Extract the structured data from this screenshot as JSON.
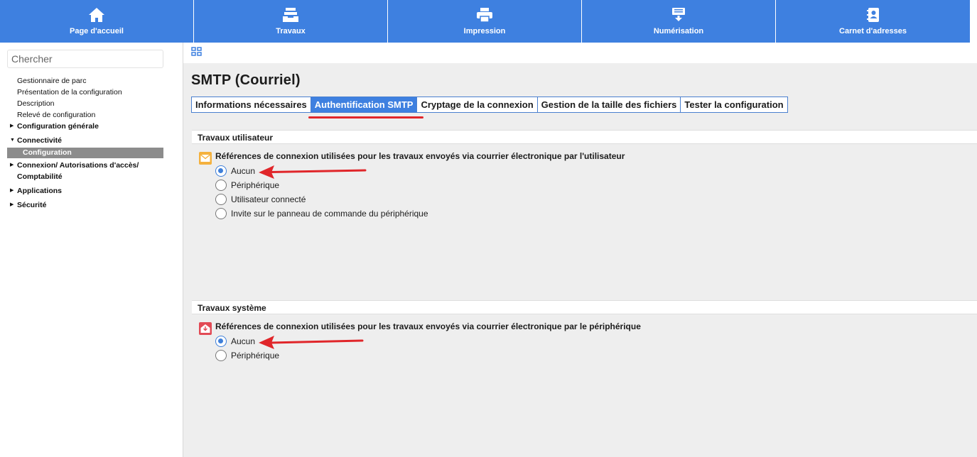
{
  "nav": {
    "items": [
      {
        "label": "Page d'accueil",
        "icon": "home-icon"
      },
      {
        "label": "Travaux",
        "icon": "jobs-icon"
      },
      {
        "label": "Impression",
        "icon": "printer-icon"
      },
      {
        "label": "Numérisation",
        "icon": "scan-icon"
      },
      {
        "label": "Carnet d'adresses",
        "icon": "address-book-icon"
      }
    ]
  },
  "sidebar": {
    "search_placeholder": "Chercher",
    "items": [
      {
        "label": "Gestionnaire de parc"
      },
      {
        "label": "Présentation de la configuration"
      },
      {
        "label": "Description"
      },
      {
        "label": "Relevé de configuration"
      },
      {
        "label": "Configuration générale"
      },
      {
        "label": "Connectivité"
      },
      {
        "label": "Configuration"
      },
      {
        "label": "Connexion/ Autorisations d'accès/ Comptabilité"
      },
      {
        "label": "Applications"
      },
      {
        "label": "Sécurité"
      }
    ]
  },
  "page": {
    "title": "SMTP (Courriel)",
    "tabs": [
      {
        "label": "Informations nécessaires"
      },
      {
        "label": "Authentification SMTP"
      },
      {
        "label": "Cryptage de la connexion"
      },
      {
        "label": "Gestion de la taille des fichiers"
      },
      {
        "label": "Tester la configuration"
      }
    ],
    "active_tab": "Authentification SMTP"
  },
  "sections": {
    "user": {
      "heading": "Travaux utilisateur",
      "field_label": "Références de connexion utilisées pour les travaux envoyés via courrier électronique par l'utilisateur",
      "options": [
        "Aucun",
        "Périphérique",
        "Utilisateur connecté",
        "Invite sur le panneau de commande du périphérique"
      ],
      "selected": "Aucun"
    },
    "system": {
      "heading": "Travaux système",
      "field_label": "Références de connexion utilisées pour les travaux envoyés via courrier électronique par le périphérique",
      "options": [
        "Aucun",
        "Périphérique"
      ],
      "selected": "Aucun"
    }
  },
  "colors": {
    "brand": "#3e80e0",
    "annotation": "#e0262a",
    "selected_item": "#8c8c8c"
  }
}
